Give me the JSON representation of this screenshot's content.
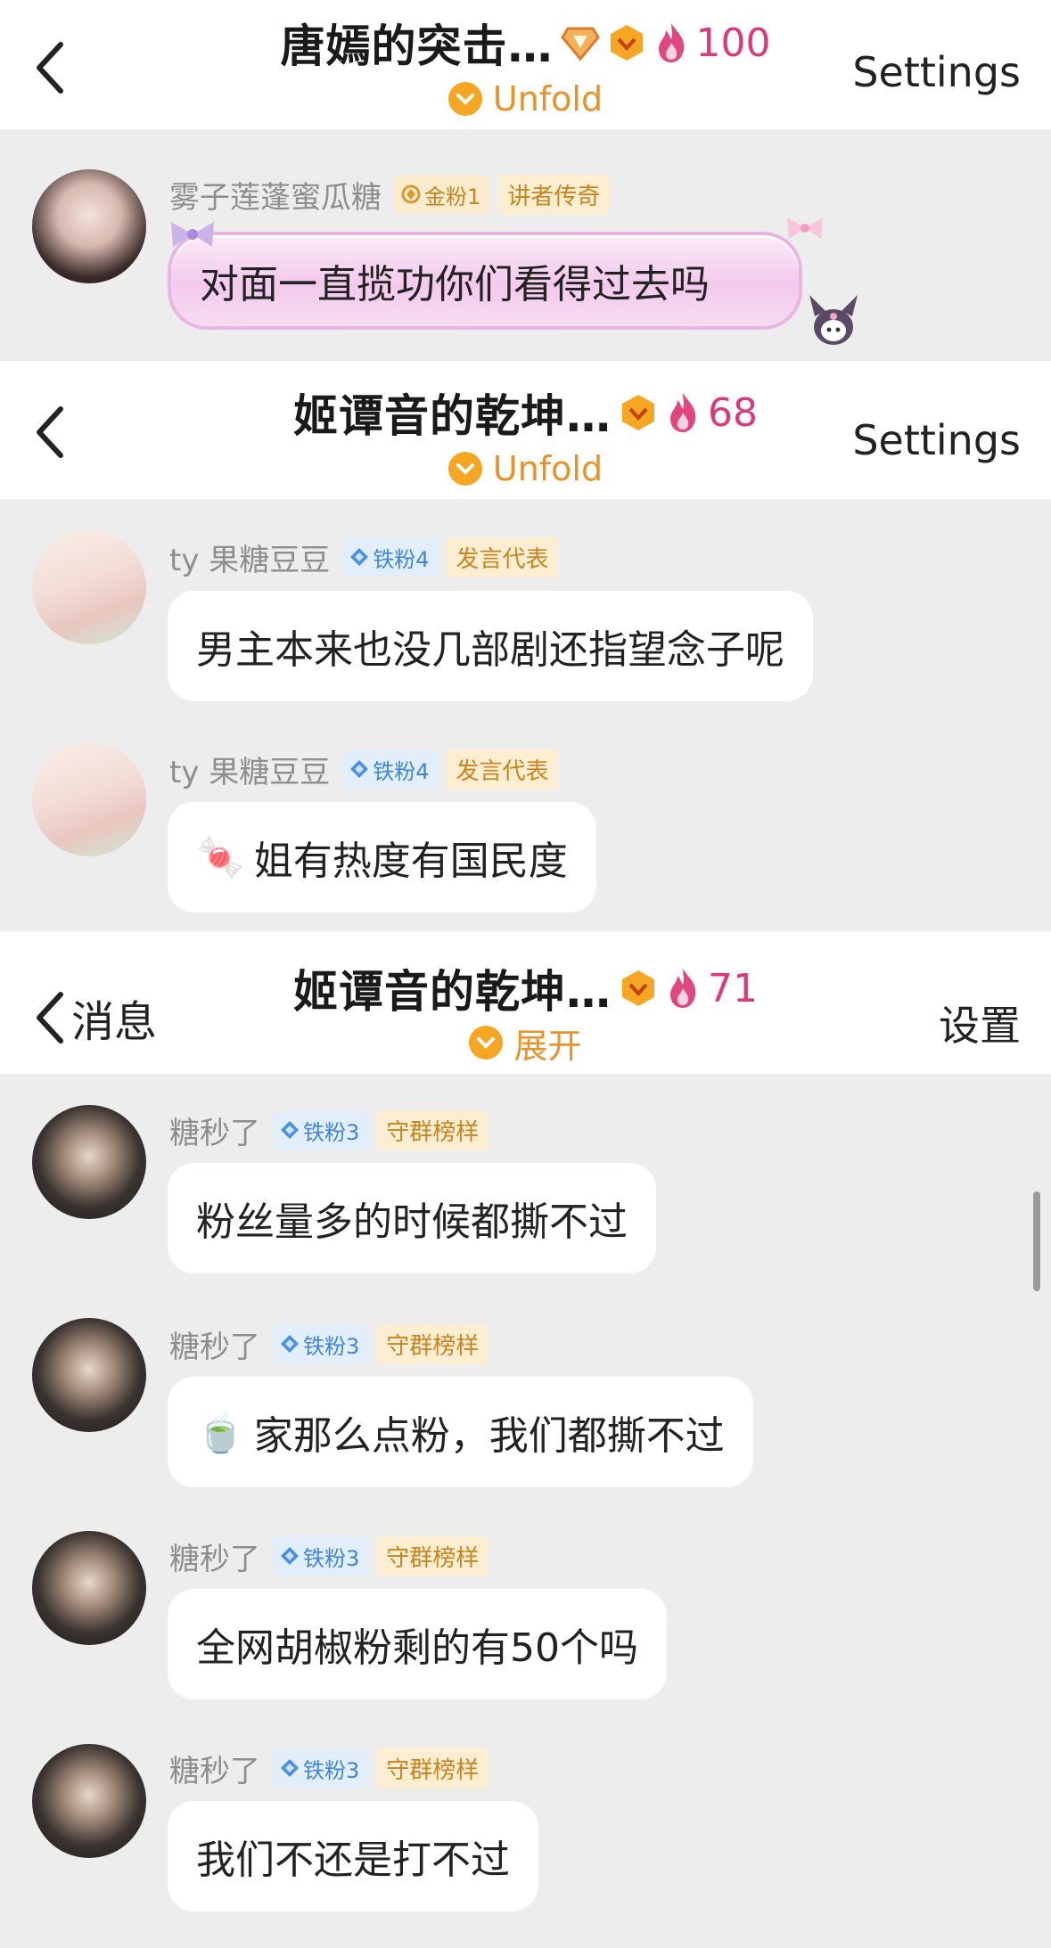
{
  "panels": [
    {
      "back_text": "",
      "title": "唐嫣的突击…",
      "count": "100",
      "unfold": "Unfold",
      "settings": "Settings",
      "messages": [
        {
          "username": "雾子莲蓬蜜瓜糖",
          "fan_tag": "金粉1",
          "fan_color": "gold",
          "role": "讲者传奇",
          "text": "对面一直揽功你们看得过去吗",
          "style": "pink"
        }
      ]
    },
    {
      "back_text": "",
      "title": "姬谭音的乾坤…",
      "count": "68",
      "unfold": "Unfold",
      "settings": "Settings",
      "messages": [
        {
          "username": "ty 果糖豆豆",
          "fan_tag": "铁粉4",
          "fan_color": "blue",
          "role": "发言代表",
          "text": "男主本来也没几部剧还指望念子呢",
          "emoji": ""
        },
        {
          "username": "ty 果糖豆豆",
          "fan_tag": "铁粉4",
          "fan_color": "blue",
          "role": "发言代表",
          "text": "姐有热度有国民度",
          "emoji": "🍬"
        }
      ]
    },
    {
      "back_text": "消息",
      "title": "姬谭音的乾坤…",
      "count": "71",
      "unfold": "展开",
      "settings": "设置",
      "messages": [
        {
          "username": "糖秒了",
          "fan_tag": "铁粉3",
          "fan_color": "blue",
          "role": "守群榜样",
          "text": "粉丝量多的时候都撕不过",
          "emoji": ""
        },
        {
          "username": "糖秒了",
          "fan_tag": "铁粉3",
          "fan_color": "blue",
          "role": "守群榜样",
          "text": "家那么点粉，我们都撕不过",
          "emoji": "🍵"
        },
        {
          "username": "糖秒了",
          "fan_tag": "铁粉3",
          "fan_color": "blue",
          "role": "守群榜样",
          "text": "全网胡椒粉剩的有50个吗",
          "emoji": ""
        },
        {
          "username": "糖秒了",
          "fan_tag": "铁粉3",
          "fan_color": "blue",
          "role": "守群榜样",
          "text": "我们不还是打不过",
          "emoji": ""
        }
      ]
    }
  ],
  "icons": {
    "back": "chevron-left-icon",
    "level": "diamond-level-icon",
    "fire": "fire-icon",
    "unfold": "chevron-down-icon",
    "fan": "diamond-icon"
  },
  "colors": {
    "header_bg": "#ffffff",
    "chat_bg": "#ededed",
    "count": "#d83a7d",
    "unfold": "#e8932a",
    "tag_blue": "#3f86d9",
    "tag_gold": "#c88420"
  }
}
